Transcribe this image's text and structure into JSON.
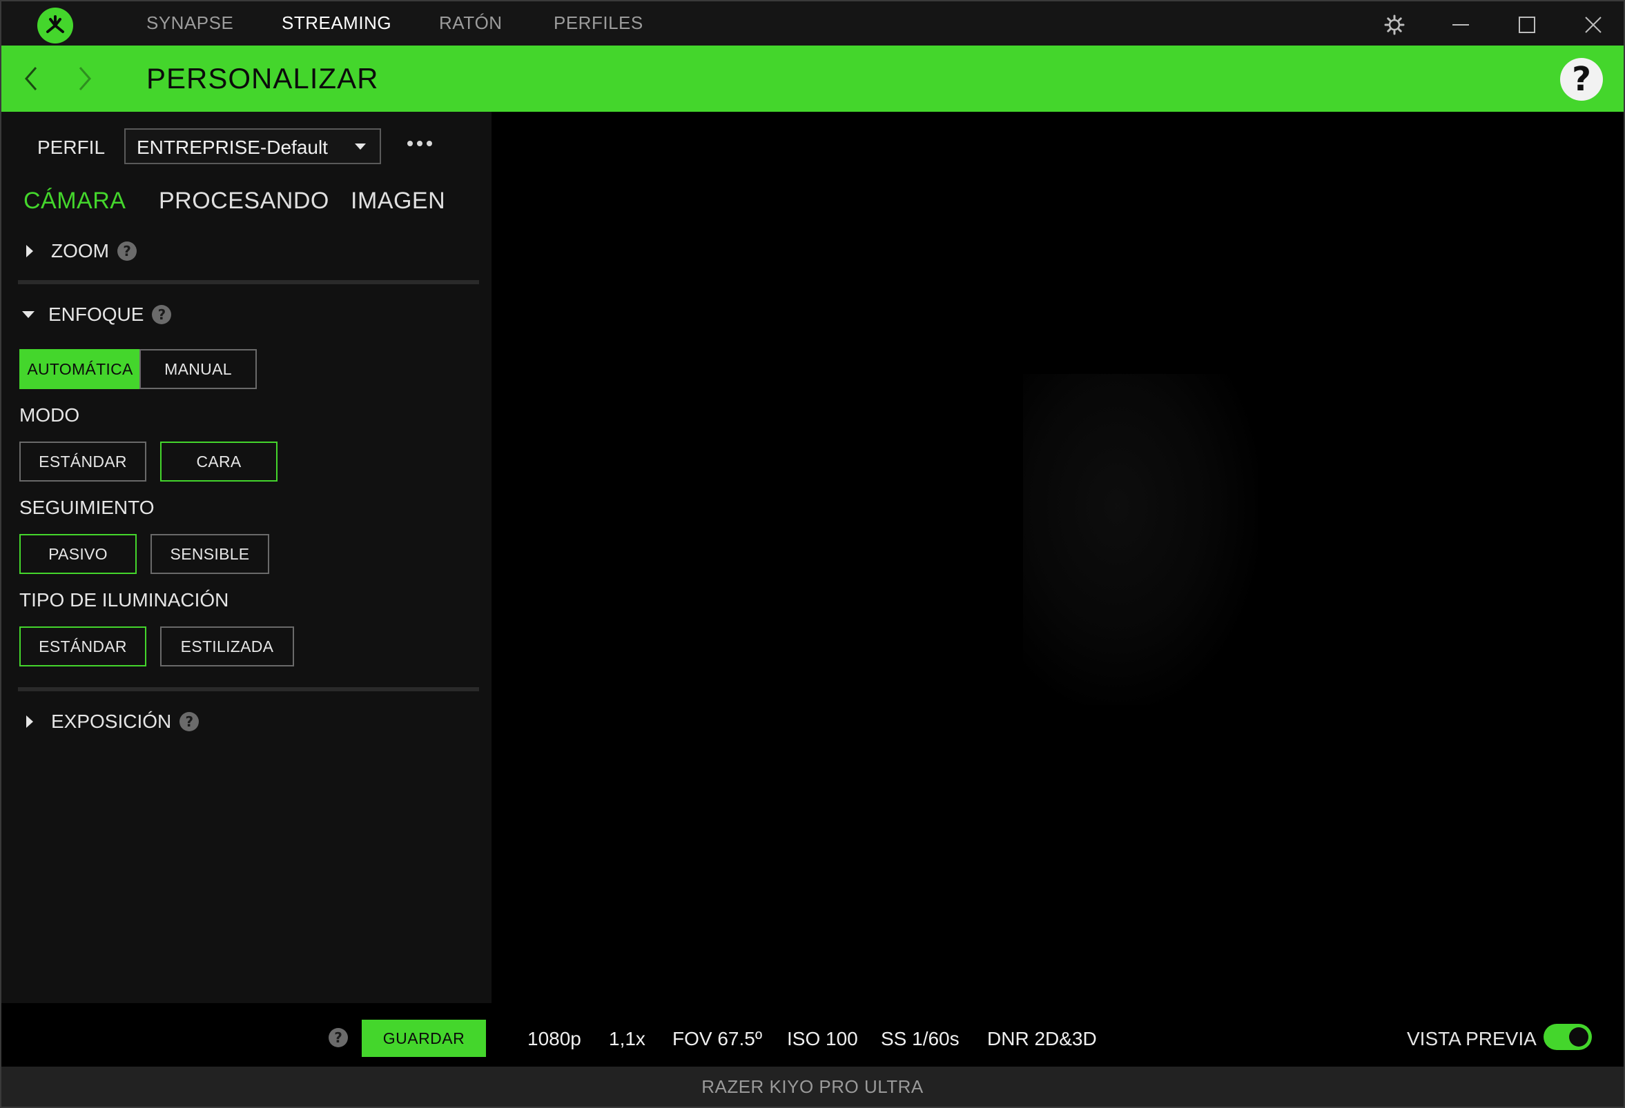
{
  "topnav": {
    "tabs": [
      "SYNAPSE",
      "STREAMING",
      "RATÓN",
      "PERFILES"
    ],
    "active": "STREAMING"
  },
  "header": {
    "title": "PERSONALIZAR",
    "help": "?"
  },
  "profile": {
    "label": "PERFIL",
    "value": "ENTREPRISE-Default"
  },
  "subtabs": {
    "items": [
      "CÁMARA",
      "PROCESANDO",
      "IMAGEN"
    ],
    "active": "CÁMARA"
  },
  "sections": {
    "zoom": "ZOOM",
    "enfoque": "ENFOQUE",
    "exposicion": "EXPOSICIÓN",
    "help": "?"
  },
  "enfoque": {
    "modes": [
      "AUTOMÁTICA",
      "MANUAL"
    ],
    "selected_mode": "AUTOMÁTICA",
    "modo": {
      "label": "MODO",
      "options": [
        "ESTÁNDAR",
        "CARA"
      ],
      "selected": "CARA"
    },
    "seguimiento": {
      "label": "SEGUIMIENTO",
      "options": [
        "PASIVO",
        "SENSIBLE"
      ],
      "selected": "PASIVO"
    },
    "iluminacion": {
      "label": "TIPO DE ILUMINACIÓN",
      "options": [
        "ESTÁNDAR",
        "ESTILIZADA"
      ],
      "selected": "ESTÁNDAR"
    }
  },
  "bottom": {
    "help": "?",
    "save_label": "GUARDAR",
    "stats": [
      "1080p",
      "1,1x",
      "FOV 67.5º",
      "ISO 100",
      "SS 1/60s",
      "DNR 2D&3D"
    ],
    "preview_label": "VISTA PREVIA",
    "preview_on": true
  },
  "status": {
    "device": "RAZER KIYO PRO ULTRA"
  },
  "colors": {
    "accent": "#44d62c",
    "panel": "#111111",
    "background": "#000000"
  },
  "icons": [
    "razer-logo-icon",
    "settings-icon",
    "minimize-icon",
    "maximize-icon",
    "close-icon",
    "back-icon",
    "forward-icon",
    "help-icon",
    "more-icon"
  ]
}
